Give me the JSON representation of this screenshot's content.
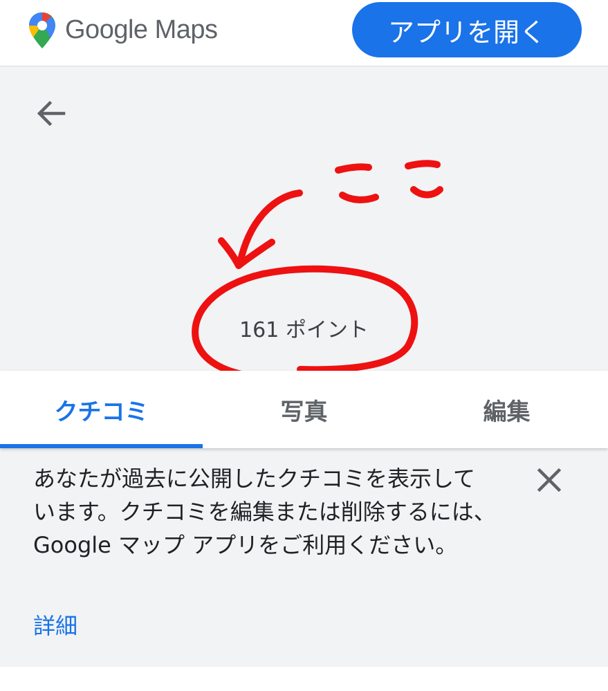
{
  "header": {
    "brand": "Google Maps",
    "open_app_label": "アプリを開く",
    "logo_icon": "google-maps-pin-icon"
  },
  "profile": {
    "back_icon": "arrow-back-icon",
    "points": "161 ポイント"
  },
  "annotation": {
    "text": "ここ",
    "color": "#ee1111"
  },
  "tabs": [
    {
      "label": "クチコミ",
      "active": true
    },
    {
      "label": "写真",
      "active": false
    },
    {
      "label": "編集",
      "active": false
    }
  ],
  "notice": {
    "text": "あなたが過去に公開したクチコミを表示しています。クチコミを編集または削除するには、Google マップ アプリをご利用ください。",
    "close_icon": "close-icon",
    "details_link": "詳細"
  },
  "colors": {
    "accent": "#1a73e8",
    "background": "#f1f3f4",
    "text": "#202124",
    "muted": "#5f6368"
  }
}
